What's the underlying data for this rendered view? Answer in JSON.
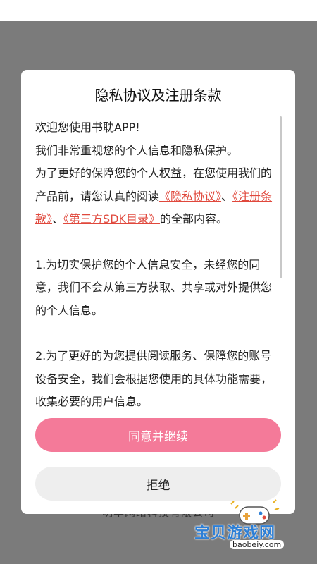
{
  "background": {
    "company_text": "明丰网络科技有限公司"
  },
  "dialog": {
    "title": "隐私协议及注册条款",
    "intro": {
      "line1": "欢迎您使用书耽APP!",
      "line2": "我们非常重视您的个人信息和隐私保护。",
      "line3a": "为了更好的保障您的个人权益，在您使用我们的产品前，请您认真的阅读",
      "link_privacy": "《隐私协议》",
      "sep1": "、",
      "link_terms": "《注册条款》",
      "sep2": "、",
      "link_sdk": "《第三方SDK目录》",
      "line3b": "的全部内容。"
    },
    "para1": "1.为切实保护您的个人信息安全，未经您的同意，我们不会从第三方获取、共享或对外提供您的个人信息。",
    "para2": "2.为了更好的为您提供阅读服务、保障您的账号设备安全，我们会根据您使用的具体功能需要，收集必要的用户信息。",
    "agree_label": "同意并继续",
    "reject_label": "拒绝"
  },
  "watermark": {
    "text": "宝贝游戏网",
    "url": "baobeiy.com"
  },
  "colors": {
    "agree_button": "#f47a99",
    "link": "#e0483c",
    "overlay": "#7b7b7b"
  }
}
